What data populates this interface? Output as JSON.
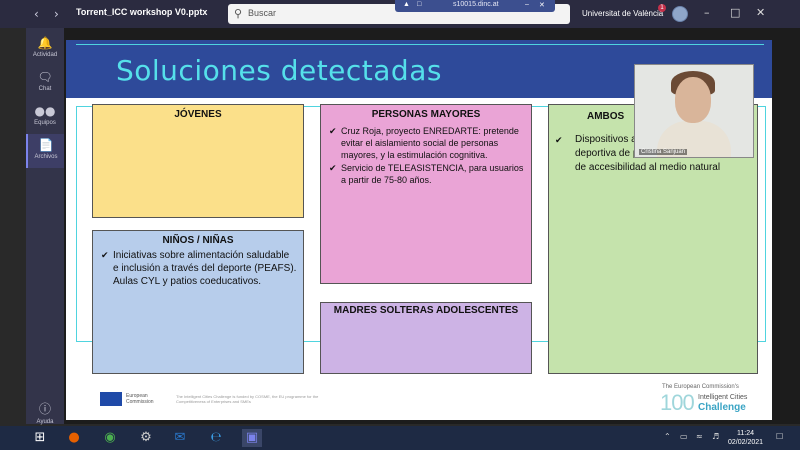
{
  "window": {
    "title": "Torrent_ICC workshop V0.pptx",
    "search_placeholder": "Buscar",
    "share_label": "s10015.dinc.at",
    "organization": "Universitat de València",
    "notification_count": "1"
  },
  "rail": {
    "items": [
      {
        "label": "Actividad",
        "icon": "bell-icon"
      },
      {
        "label": "Chat",
        "icon": "chat-icon"
      },
      {
        "label": "Equipos",
        "icon": "teams-icon"
      },
      {
        "label": "Archivos",
        "icon": "files-icon"
      }
    ],
    "help_label": "Ayuda"
  },
  "slide": {
    "title": "Soluciones detectadas",
    "notes": {
      "jovenes": {
        "title": "JÓVENES",
        "color": "#fbe08a"
      },
      "ninos": {
        "title": "NIÑOS / NIÑAS",
        "color": "#b7cdeb",
        "items": [
          "Iniciativas sobre alimentación saludable e inclusión a través del deporte (PEAFS). Aulas CYL y patios coeducativos."
        ]
      },
      "mayores": {
        "title": "PERSONAS MAYORES",
        "color": "#eaa4d6",
        "items": [
          "Cruz Roja, proyecto ENREDARTE: pretende evitar el aislamiento social de personas mayores, y la estimulación cognitiva.",
          "Servicio de TELEASISTENCIA, para usuarios a partir de 75-80 años."
        ]
      },
      "madres": {
        "title": "MADRES SOLTERAS ADOLESCENTES",
        "color": "#cdb3e5"
      },
      "ambos": {
        "title": "AMBOS",
        "color": "#c5e3ac",
        "items": [
          "Dispositivos adaptados para la práctica deportiva de personas con problemas de accesibilidad al medio natural"
        ]
      }
    },
    "video_name": "Cristina Sanjuan",
    "footer": {
      "eu_line1": "European",
      "eu_line2": "Commission",
      "small_text": "The Intelligent Cities Challenge is funded by COSME, the EU programme for the Competitiveness of Enterprises and SMEs",
      "ic_top": "The European Commission's",
      "ic_100": "100",
      "ic_sub1": "Intelligent Cities",
      "ic_sub2": "Challenge"
    }
  },
  "taskbar": {
    "time": "11:24",
    "date": "02/02/2021"
  }
}
